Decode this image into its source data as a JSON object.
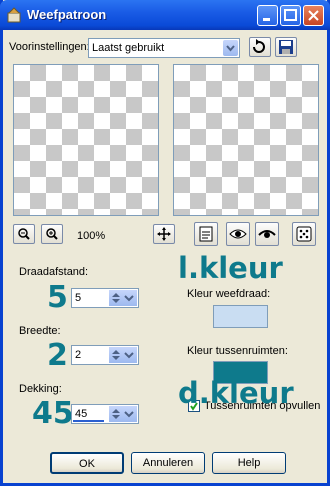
{
  "window": {
    "title": "Weefpatroon"
  },
  "presets": {
    "label": "Voorinstellingen:",
    "value": "Laatst gebruikt"
  },
  "zoom": {
    "value": "100%"
  },
  "labels": {
    "draadafstand": "Draadafstand:",
    "breedte": "Breedte:",
    "dekking": "Dekking:",
    "kleur_weefdraad": "Kleur weefdraad:",
    "kleur_tussenruimten": "Kleur tussenruimten:",
    "tussenruimten_opvullen": "Tussenruimten opvullen"
  },
  "fields": {
    "draadafstand": "5",
    "breedte": "2",
    "dekking": "45"
  },
  "annotations": {
    "n1": "5",
    "n2": "2",
    "n3": "45",
    "l_kleur": "l.kleur",
    "d_kleur": "d.kleur"
  },
  "colors": {
    "weefdraad": "#c9ddf2",
    "tussenruimten": "#0e7a8c",
    "annotation": "#0e7a8c"
  },
  "buttons": {
    "ok": "OK",
    "annuleren": "Annuleren",
    "help": "Help"
  }
}
